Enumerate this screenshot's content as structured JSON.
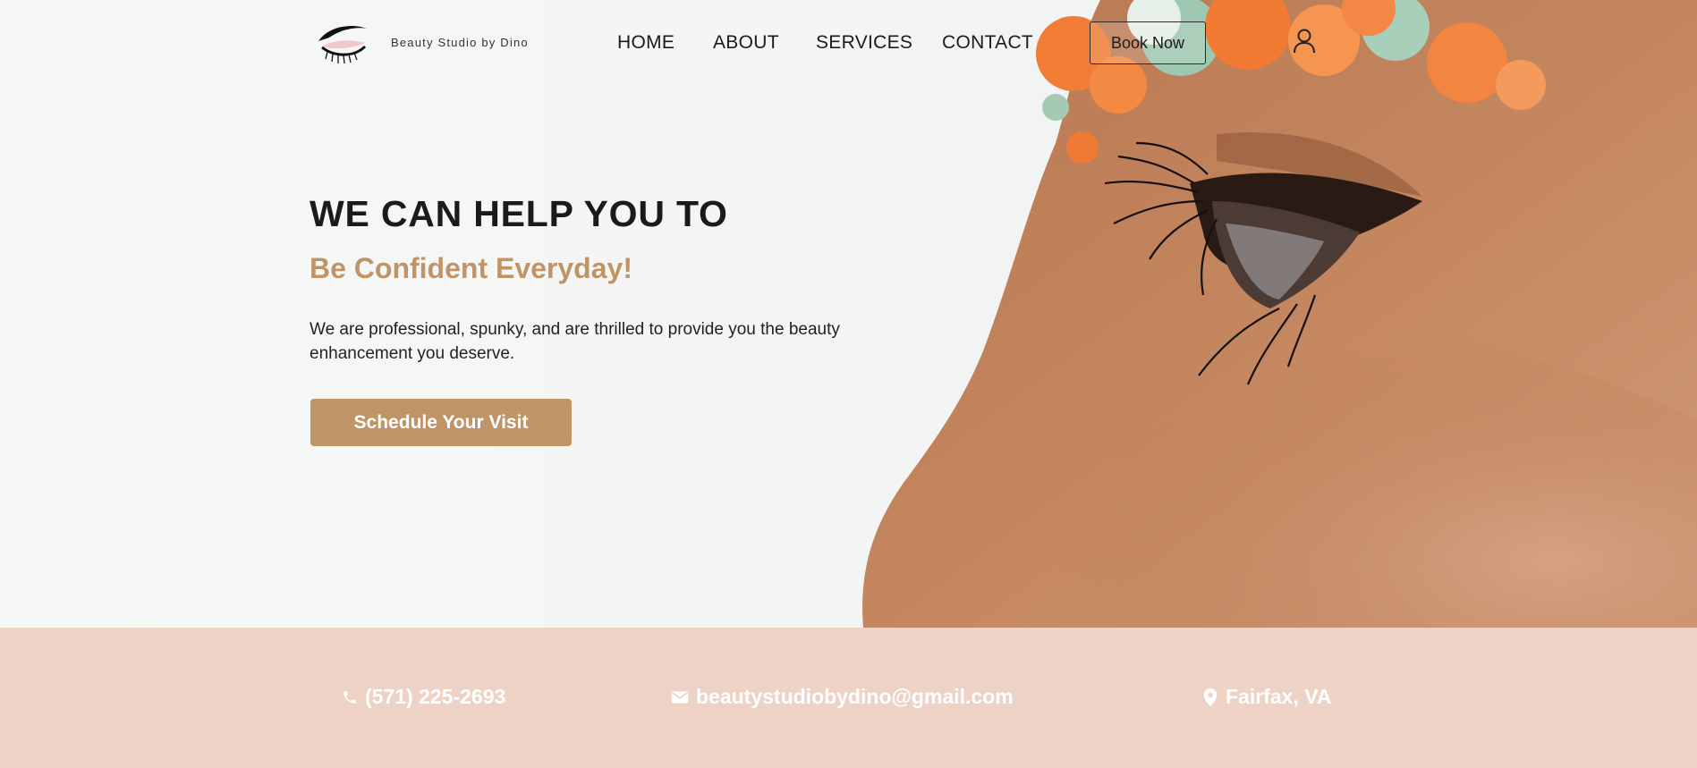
{
  "header": {
    "brand": "Beauty Studio by Dino",
    "nav": [
      "HOME",
      "ABOUT",
      "SERVICES",
      "CONTACT"
    ],
    "book_label": "Book Now"
  },
  "hero": {
    "headline": "WE CAN HELP YOU TO",
    "subheadline": "Be Confident Everyday!",
    "body": "We are professional, spunky, and are thrilled to provide you the beauty enhancement you deserve.",
    "cta_label": "Schedule Your Visit"
  },
  "contact": {
    "phone": "(571) 225-2693",
    "email": "beautystudiobydino@gmail.com",
    "location": "Fairfax, VA"
  },
  "colors": {
    "accent": "#bf9568",
    "contact_bar": "#efd2c6",
    "text_dark": "#1b1b1b"
  },
  "icons": [
    "eyelash-logo-icon",
    "user-icon",
    "phone-icon",
    "mail-icon",
    "location-pin-icon"
  ]
}
